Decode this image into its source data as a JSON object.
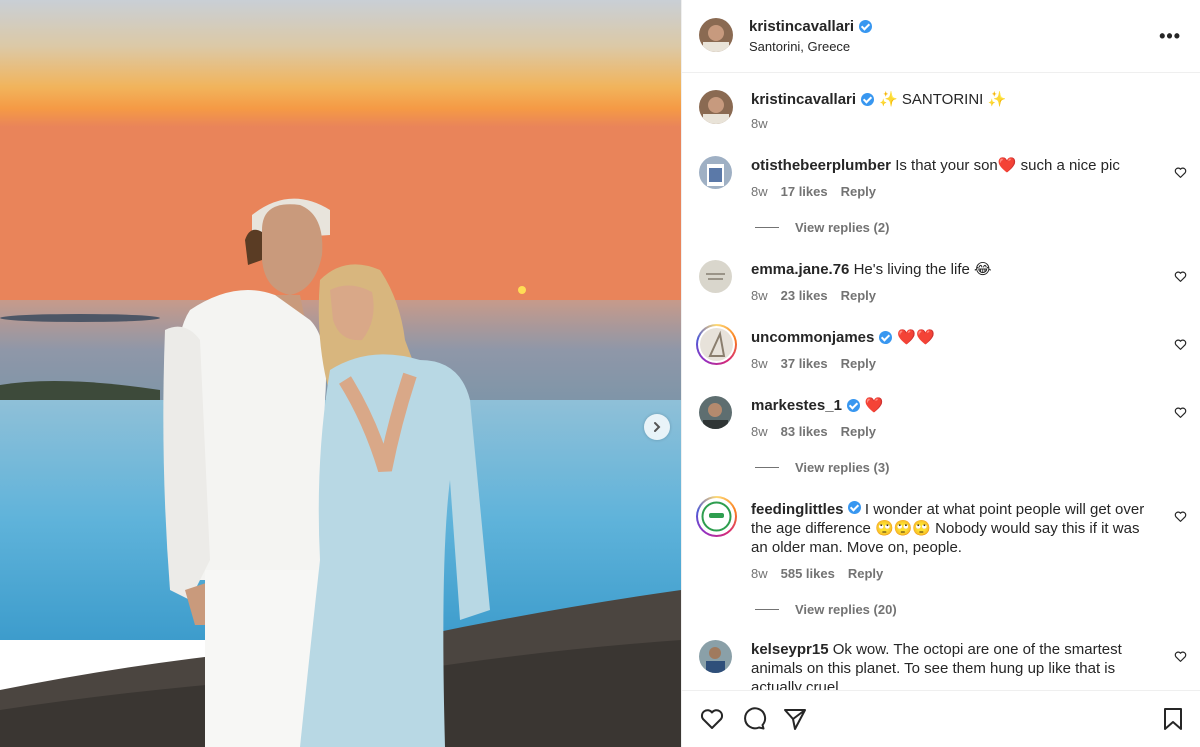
{
  "post": {
    "username": "kristincavallari",
    "location": "Santorini, Greece",
    "more_label": "•••",
    "caption": {
      "username": "kristincavallari",
      "text": "✨ SANTORINI ✨",
      "time": "8w"
    }
  },
  "comments": [
    {
      "username": "otisthebeerplumber",
      "verified": false,
      "text": "Is that your son❤️ such a nice pic",
      "time": "8w",
      "likes": "17 likes",
      "reply": "Reply",
      "view_replies": "View replies (2)"
    },
    {
      "username": "emma.jane.76",
      "verified": false,
      "text": "He's living the life 😂",
      "time": "8w",
      "likes": "23 likes",
      "reply": "Reply"
    },
    {
      "username": "uncommonjames",
      "verified": true,
      "text": "❤️❤️",
      "time": "8w",
      "likes": "37 likes",
      "reply": "Reply"
    },
    {
      "username": "markestes_1",
      "verified": true,
      "text": "❤️",
      "time": "8w",
      "likes": "83 likes",
      "reply": "Reply",
      "view_replies": "View replies (3)"
    },
    {
      "username": "feedinglittles",
      "verified": true,
      "text": "I wonder at what point people will get over the age difference 🙄🙄🙄 Nobody would say this if it was an older man. Move on, people.",
      "time": "8w",
      "likes": "585 likes",
      "reply": "Reply",
      "view_replies": "View replies (20)"
    },
    {
      "username": "kelseypr15",
      "verified": false,
      "text": "Ok wow. The octopi are one of the smartest animals on this planet. To see them hung up like that is actually cruel"
    }
  ],
  "colors": {
    "verified": "#3897f0",
    "muted": "#737373",
    "text": "#262626"
  },
  "icons": [
    "like-icon",
    "comment-icon",
    "share-icon",
    "save-icon",
    "next-arrow-icon",
    "verified-icon"
  ]
}
